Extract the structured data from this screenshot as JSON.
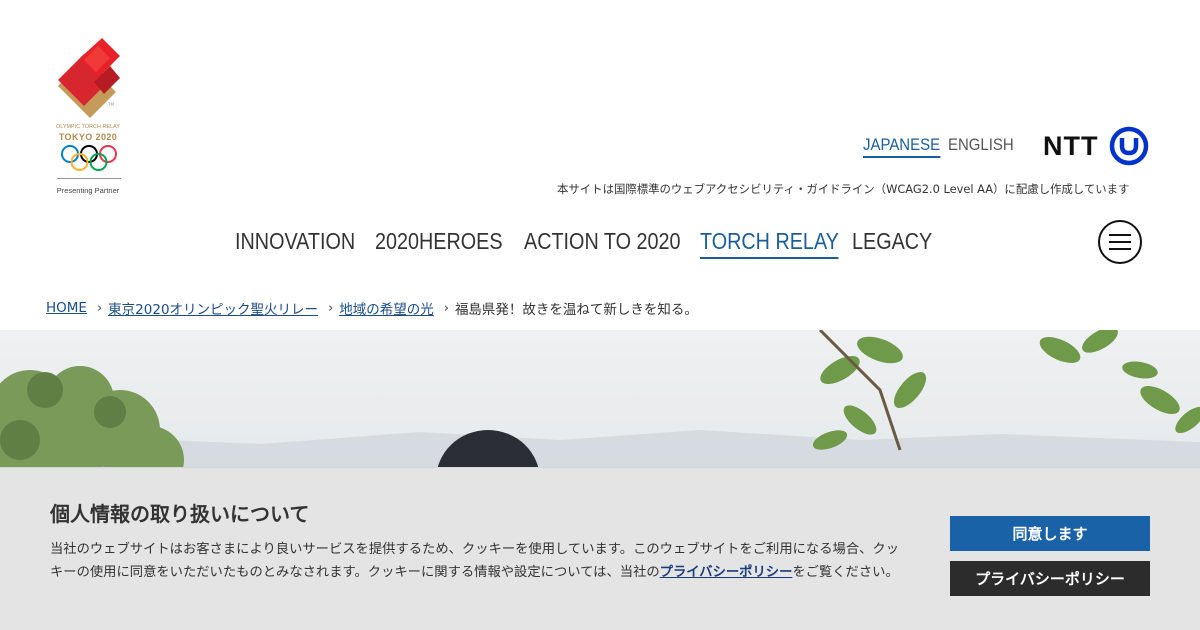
{
  "logo": {
    "relay_text": "OLYMPIC TORCH RELAY",
    "event_text": "TOKYO 2020",
    "trademark": "TM",
    "partner_text": "Presenting Partner",
    "icon": "olympic-torch-relay-emblem"
  },
  "language": {
    "japanese": "JAPANESE",
    "english": "ENGLISH",
    "active": "JAPANESE"
  },
  "brand": {
    "name": "NTT",
    "icon": "ntt-logo-icon",
    "color": "#0033cc"
  },
  "accessibility_note": "本サイトは国際標準のウェブアクセシビリティ・ガイドライン（WCAG2.0 Level AA）に配慮し作成しています",
  "nav": {
    "items": [
      {
        "label": "INNOVATION"
      },
      {
        "label": "2020HEROES"
      },
      {
        "label": "ACTION TO 2020"
      },
      {
        "label": "TORCH RELAY"
      },
      {
        "label": "LEGACY"
      }
    ],
    "active": "TORCH RELAY",
    "menu_icon": "hamburger-menu-icon"
  },
  "breadcrumb": {
    "items": [
      {
        "label": "HOME"
      },
      {
        "label": "東京2020オリンピック聖火リレー"
      },
      {
        "label": "地域の希望の光"
      }
    ],
    "current": "福島県発！故きを温ねて新しきを知る。"
  },
  "cookie": {
    "title": "個人情報の取り扱いについて",
    "text_before": "当社のウェブサイトはお客さまにより良いサービスを提供するため、クッキーを使用しています。このウェブサイトをご利用になる場合、クッキーの使用に同意をいただいたものとみなされます。クッキーに関する情報や設定については、当社の",
    "link_label": "プライバシーポリシー",
    "text_after": "をご覧ください。",
    "agree_label": "同意します",
    "policy_label": "プライバシーポリシー"
  },
  "colors": {
    "accent": "#1a5d9a",
    "agree_button": "#1a62a8",
    "policy_button": "#2c2c2c",
    "banner_bg": "#e4e4e4"
  }
}
